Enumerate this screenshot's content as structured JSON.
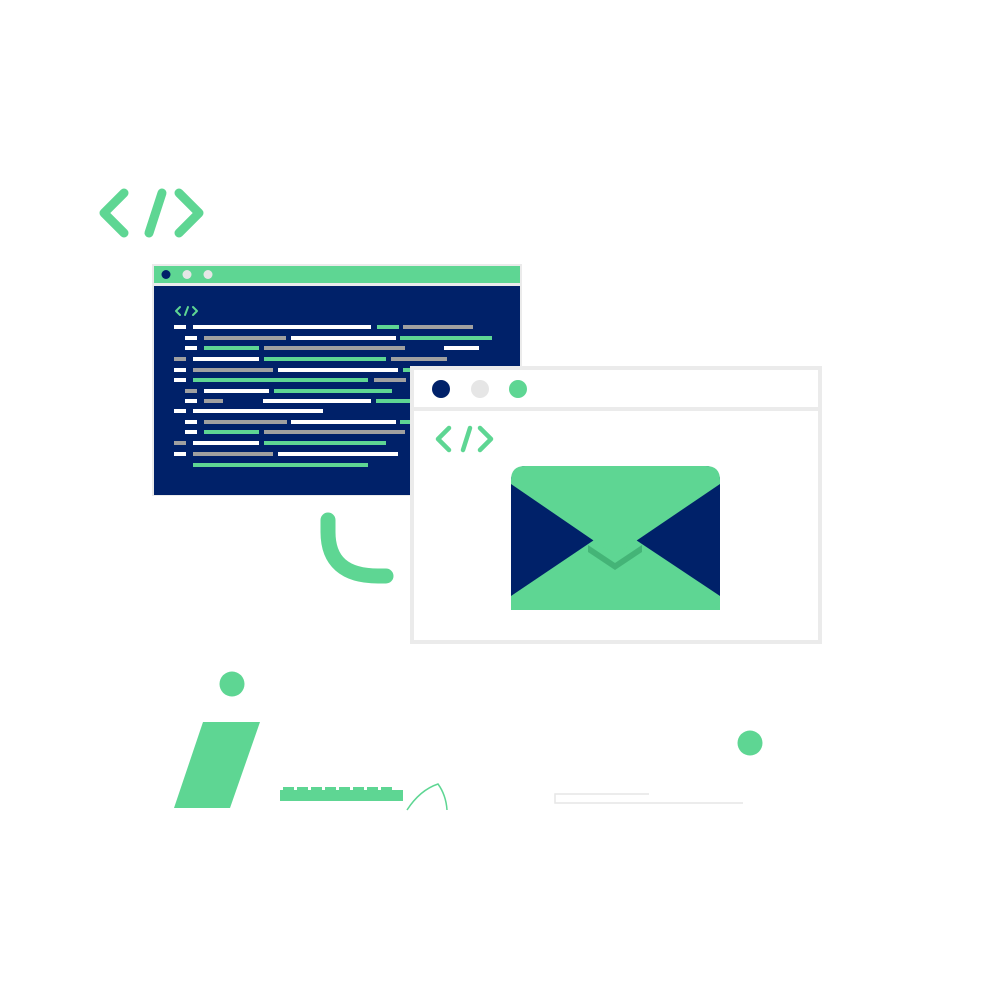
{
  "colors": {
    "accent": "#5ed693",
    "navy": "#002169",
    "frame": "#ebebeb",
    "light_dot": "#e6e6e6",
    "code_gray": "#a0a0a0",
    "code_white": "#ffffff",
    "envelope_shadow": "#3fae72"
  },
  "icons": {
    "large_code_tag": "code-tag-icon",
    "editor_code_tag": "code-tag-icon",
    "mail_code_tag": "code-tag-icon",
    "envelope": "envelope-icon"
  },
  "code_editor": {
    "window_dots": [
      "navy",
      "light",
      "light"
    ]
  },
  "mail_window": {
    "window_dots": [
      "navy",
      "light",
      "accent"
    ]
  }
}
